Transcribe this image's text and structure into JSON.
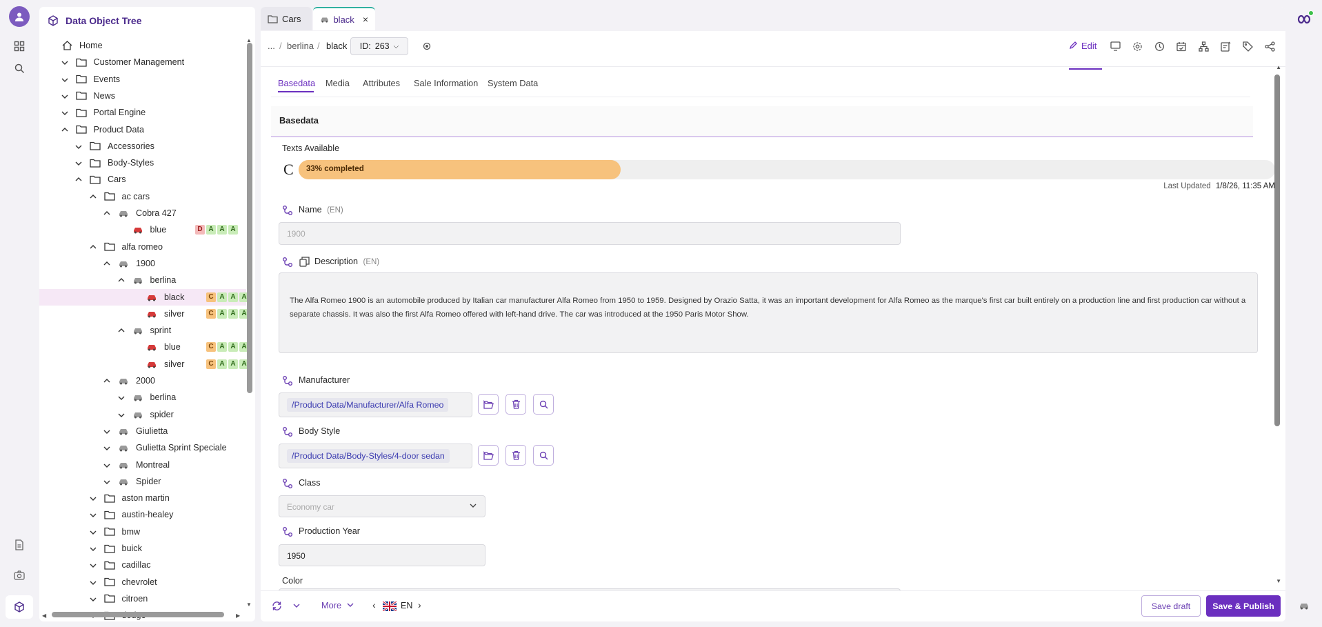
{
  "tree": {
    "title": "Data Object Tree",
    "rows": [
      {
        "label": "Home",
        "type": "home",
        "level": 0
      },
      {
        "label": "Customer Management",
        "type": "folder",
        "level": 1,
        "chev": "down"
      },
      {
        "label": "Events",
        "type": "folder",
        "level": 1,
        "chev": "down"
      },
      {
        "label": "News",
        "type": "folder",
        "level": 1,
        "chev": "down"
      },
      {
        "label": "Portal Engine",
        "type": "folder",
        "level": 1,
        "chev": "down"
      },
      {
        "label": "Product Data",
        "type": "folder",
        "level": 1,
        "chev": "up"
      },
      {
        "label": "Accessories",
        "type": "folder",
        "level": 2,
        "chev": "down"
      },
      {
        "label": "Body-Styles",
        "type": "folder",
        "level": 2,
        "chev": "down"
      },
      {
        "label": "Cars",
        "type": "folder",
        "level": 2,
        "chev": "up"
      },
      {
        "label": "ac cars",
        "type": "folder",
        "level": 3,
        "chev": "up"
      },
      {
        "label": "Cobra 427",
        "type": "car-grey",
        "level": 4,
        "chev": "up"
      },
      {
        "label": "blue",
        "type": "car-red",
        "level": 5,
        "badges": [
          "D",
          "A",
          "A",
          "A"
        ]
      },
      {
        "label": "alfa romeo",
        "type": "folder",
        "level": 3,
        "chev": "up"
      },
      {
        "label": "1900",
        "type": "car-grey",
        "level": 4,
        "chev": "up"
      },
      {
        "label": "berlina",
        "type": "car-grey",
        "level": 5,
        "chev": "up"
      },
      {
        "label": "black",
        "type": "car-red",
        "level": 6,
        "badges": [
          "C",
          "A",
          "A",
          "A"
        ],
        "selected": true
      },
      {
        "label": "silver",
        "type": "car-red",
        "level": 6,
        "badges": [
          "C",
          "A",
          "A",
          "A"
        ]
      },
      {
        "label": "sprint",
        "type": "car-grey",
        "level": 5,
        "chev": "up"
      },
      {
        "label": "blue",
        "type": "car-red",
        "level": 6,
        "badges": [
          "C",
          "A",
          "A",
          "A"
        ]
      },
      {
        "label": "silver",
        "type": "car-red",
        "level": 6,
        "badges": [
          "C",
          "A",
          "A",
          "A"
        ]
      },
      {
        "label": "2000",
        "type": "car-grey",
        "level": 4,
        "chev": "up"
      },
      {
        "label": "berlina",
        "type": "car-grey",
        "level": 5,
        "chev": "down"
      },
      {
        "label": "spider",
        "type": "car-grey",
        "level": 5,
        "chev": "down"
      },
      {
        "label": "Giulietta",
        "type": "car-grey",
        "level": 4,
        "chev": "down"
      },
      {
        "label": "Gulietta Sprint Speciale",
        "type": "car-grey",
        "level": 4,
        "chev": "down"
      },
      {
        "label": "Montreal",
        "type": "car-grey",
        "level": 4,
        "chev": "down"
      },
      {
        "label": "Spider",
        "type": "car-grey",
        "level": 4,
        "chev": "down"
      },
      {
        "label": "aston martin",
        "type": "folder",
        "level": 3,
        "chev": "down"
      },
      {
        "label": "austin-healey",
        "type": "folder",
        "level": 3,
        "chev": "down"
      },
      {
        "label": "bmw",
        "type": "folder",
        "level": 3,
        "chev": "down"
      },
      {
        "label": "buick",
        "type": "folder",
        "level": 3,
        "chev": "down"
      },
      {
        "label": "cadillac",
        "type": "folder",
        "level": 3,
        "chev": "down"
      },
      {
        "label": "chevrolet",
        "type": "folder",
        "level": 3,
        "chev": "down"
      },
      {
        "label": "citroen",
        "type": "folder",
        "level": 3,
        "chev": "down"
      },
      {
        "label": "dodge",
        "type": "folder",
        "level": 3,
        "chev": "down"
      }
    ]
  },
  "tabs": [
    {
      "label": "Cars",
      "icon": "folder-icon"
    },
    {
      "label": "black",
      "icon": "car-icon",
      "active": true
    }
  ],
  "toolbar": {
    "breadcrumb": [
      "...",
      "berlina",
      "black"
    ],
    "id_label": "ID:",
    "id_value": "263",
    "edit_label": "Edit"
  },
  "subtabs": [
    "Basedata",
    "Media",
    "Attributes",
    "Sale Information",
    "System Data"
  ],
  "section_title": "Basedata",
  "texts_available": {
    "label": "Texts Available",
    "grade": "C",
    "progress_percent": 33,
    "progress_text": "33% completed",
    "last_updated_label": "Last Updated",
    "last_updated_value": "1/8/26, 11:35 AM"
  },
  "fields": {
    "name_label": "Name",
    "name_lang": "(EN)",
    "name_placeholder": "1900",
    "description_label": "Description",
    "description_lang": "(EN)",
    "description_text": "The Alfa Romeo 1900 is an automobile produced by Italian car manufacturer Alfa Romeo from 1950 to 1959. Designed by Orazio Satta, it was an important development for Alfa Romeo as the marque's first car built entirely on a production line and first production car without a separate chassis. It was also the first Alfa Romeo offered with left-hand drive. The car was introduced at the 1950 Paris Motor Show.",
    "manufacturer_label": "Manufacturer",
    "manufacturer_value": "/Product Data/Manufacturer/Alfa Romeo",
    "body_style_label": "Body Style",
    "body_style_value": "/Product Data/Body-Styles/4-door sedan",
    "class_label": "Class",
    "class_placeholder": "Economy car",
    "production_year_label": "Production Year",
    "production_year_value": "1950",
    "color_label": "Color"
  },
  "bottom": {
    "more_label": "More",
    "language": "EN",
    "save_draft": "Save draft",
    "save_publish": "Save & Publish"
  },
  "colors": {
    "accent": "#6b2fbf",
    "progress": "#f7c27d",
    "selected_row": "#f6e8f6"
  }
}
